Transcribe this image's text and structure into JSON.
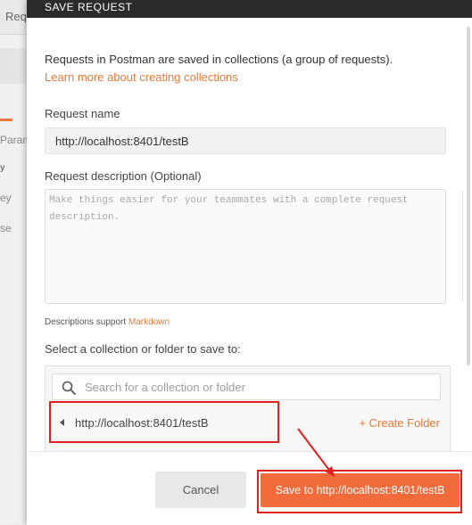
{
  "background": {
    "tab_label": "Req",
    "params_label": "Param",
    "row_labels": [
      "y",
      "ey",
      "se"
    ]
  },
  "dialog": {
    "title": "SAVE REQUEST",
    "intro_text": "Requests in Postman are saved in collections (a group of requests).",
    "learn_more_link": "Learn more about creating collections",
    "request_name_label": "Request name",
    "request_name_value": "http://localhost:8401/testB",
    "description_label": "Request description (Optional)",
    "description_placeholder": "Make things easier for your teammates with a complete request description.",
    "description_support_text": "Descriptions support ",
    "markdown_link": "Markdown",
    "collection_label": "Select a collection or folder to save to:",
    "search_placeholder": "Search for a collection or folder",
    "collection_item": "http://localhost:8401/testB",
    "create_folder_label": "+ Create Folder",
    "cancel_label": "Cancel",
    "save_label": "Save to http://localhost:8401/testB"
  },
  "icons": {
    "search": "search-icon",
    "collapse": "caret-left-icon"
  },
  "colors": {
    "accent": "#e8793a",
    "save_button": "#f26b3a",
    "header": "#2b2b2b",
    "annotation": "#e22020"
  }
}
